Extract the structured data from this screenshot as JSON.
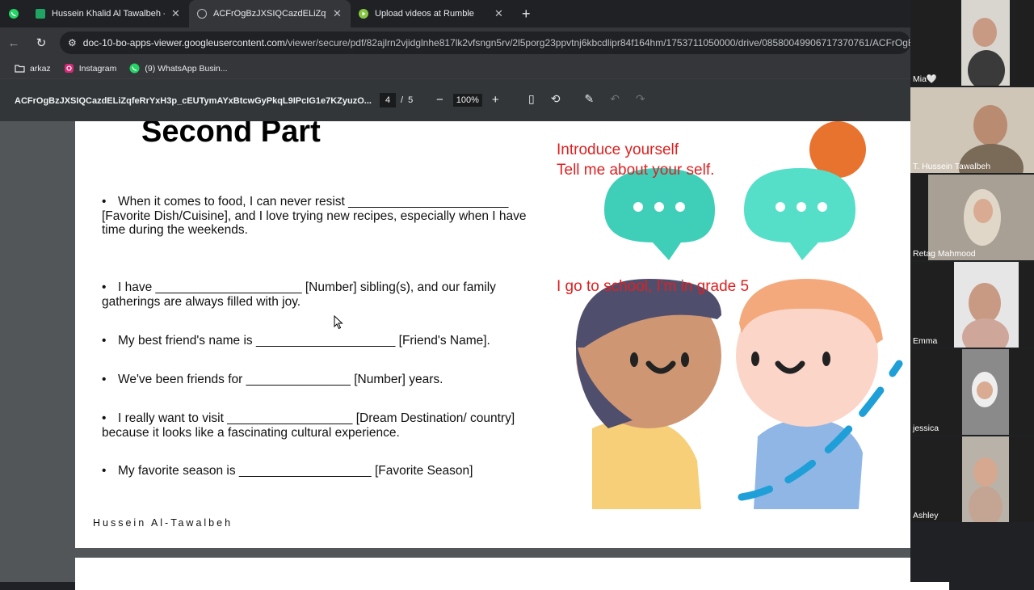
{
  "browser": {
    "tabs": [
      {
        "label": "Hussein Khalid Al Tawalbeh - G",
        "icon": "sheets-icon",
        "active": false
      },
      {
        "label": "ACFrOgBzJXSIQCazdELiZqfeRrY",
        "icon": "globe-icon",
        "active": true
      },
      {
        "label": "Upload videos at Rumble",
        "icon": "rumble-icon",
        "active": false
      }
    ],
    "url_host": "doc-10-bo-apps-viewer.googleusercontent.com",
    "url_path": "/viewer/secure/pdf/82ajlrn2vjidglnhe817lk2vfsngn5rv/2l5porg23ppvtnj6kbcdlipr84f164hm/1753711050000/drive/08580049906717370761/ACFrOgB...",
    "bookmarks": [
      {
        "label": "arkaz",
        "icon": "folder-icon"
      },
      {
        "label": "Instagram",
        "icon": "instagram-icon"
      },
      {
        "label": "(9) WhatsApp Busin...",
        "icon": "whatsapp-icon"
      }
    ]
  },
  "pdf": {
    "title": "ACFrOgBzJXSIQCazdELiZqfeRrYxH3p_cEUTymAYxBtcwGyPkqL9IPcIG1e7KZyuzO...",
    "page_current": "4",
    "page_sep": "/",
    "page_total": "5",
    "zoom": "100%"
  },
  "worksheet": {
    "heading": "Second Part",
    "items": [
      {
        "line1": "When it comes to food, I can never resist _______________________",
        "line2": "[Favorite Dish/Cuisine], and I love trying new recipes, especially when I have",
        "line3": "time during the weekends."
      },
      {
        "line1": "I have _____________________ [Number] sibling(s), and our family",
        "line2": "gatherings are always filled with joy."
      },
      {
        "line1": "My best friend's name is ____________________ [Friend's Name]."
      },
      {
        "line1": "We've been friends for _______________ [Number] years."
      },
      {
        "line1": "I really want to visit __________________ [Dream Destination/ country]",
        "line2": "because it looks like a fascinating cultural experience."
      },
      {
        "line1": "My favorite season is ___________________ [Favorite Season]"
      }
    ],
    "author": "Hussein Al-Tawalbeh"
  },
  "annotations": {
    "intro_line1": "Introduce yourself",
    "intro_line2": "Tell me about your self.",
    "grade": "I go to school, I'm in grade 5",
    "color": "#e02020"
  },
  "participants": [
    {
      "name": "Mia🤍"
    },
    {
      "name": "T. Hussein Tawalbeh"
    },
    {
      "name": "Retag Mahmood"
    },
    {
      "name": "Emma"
    },
    {
      "name": "jessica"
    },
    {
      "name": "Ashley"
    }
  ]
}
